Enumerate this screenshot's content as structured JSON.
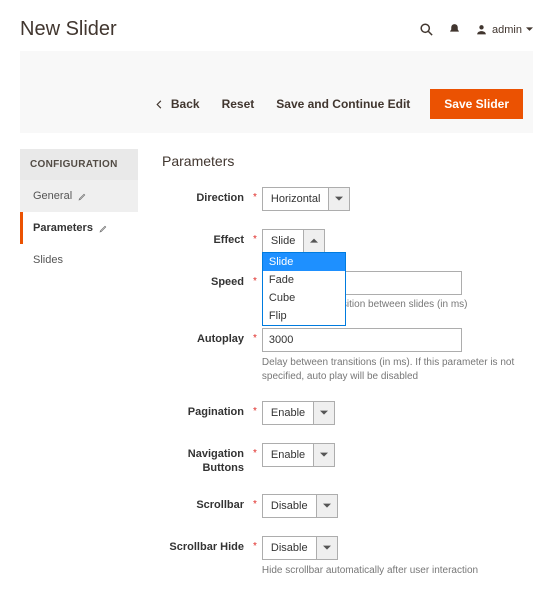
{
  "header": {
    "title": "New Slider",
    "admin_label": "admin"
  },
  "actions": {
    "back": "Back",
    "reset": "Reset",
    "save_continue": "Save and Continue Edit",
    "save": "Save Slider"
  },
  "sidebar": {
    "heading": "CONFIGURATION",
    "items": [
      {
        "label": "General"
      },
      {
        "label": "Parameters"
      },
      {
        "label": "Slides"
      }
    ]
  },
  "section": {
    "title": "Parameters"
  },
  "fields": {
    "direction": {
      "label": "Direction",
      "value": "Horizontal"
    },
    "effect": {
      "label": "Effect",
      "value": "Slide",
      "options": [
        "Slide",
        "Fade",
        "Cube",
        "Flip"
      ]
    },
    "speed": {
      "label": "Speed",
      "value": "",
      "hint_tail": "sition between slides (in ms)"
    },
    "autoplay": {
      "label": "Autoplay",
      "value": "3000",
      "hint": "Delay between transitions (in ms). If this parameter is not specified, auto play will be disabled"
    },
    "pagination": {
      "label": "Pagination",
      "value": "Enable"
    },
    "nav": {
      "label": "Navigation Buttons",
      "value": "Enable"
    },
    "scrollbar": {
      "label": "Scrollbar",
      "value": "Disable"
    },
    "scrollbar_hide": {
      "label": "Scrollbar Hide",
      "value": "Disable",
      "hint": "Hide scrollbar automatically after user interaction"
    }
  }
}
